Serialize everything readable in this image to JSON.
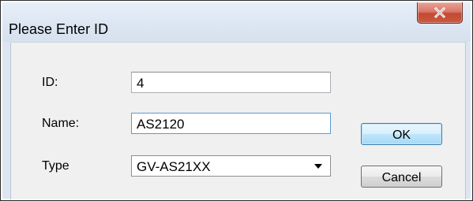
{
  "window": {
    "title": "Please Enter ID",
    "close_glyph": "x"
  },
  "form": {
    "id_label": "ID:",
    "id_value": "4",
    "name_label": "Name:",
    "name_value": "AS2120",
    "type_label": "Type",
    "type_value": "GV-AS21XX"
  },
  "buttons": {
    "ok_label": "OK",
    "cancel_label": "Cancel"
  },
  "icons": {
    "close": "close-icon",
    "dropdown": "chevron-down-icon"
  },
  "colors": {
    "titlebar": "#dce6f2",
    "close_button": "#c44a33",
    "default_button_border": "#3c7fb1",
    "focus_border": "#5b9bd5"
  }
}
